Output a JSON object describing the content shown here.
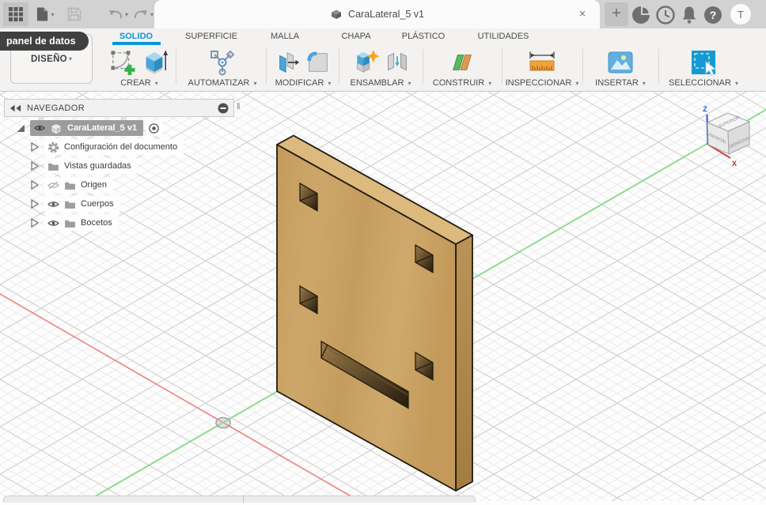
{
  "ui": {
    "caret": "▾",
    "close": "×",
    "plus": "+",
    "question": "?",
    "avatar": "T",
    "handle": "‖"
  },
  "titlebar": {
    "document_title": "CaraLateral_5 v1"
  },
  "data_panel_tooltip": "panel de datos",
  "design_menu": {
    "label": "DISEÑO"
  },
  "ribbon": {
    "tabs": [
      {
        "label": "SOLIDO",
        "active": true
      },
      {
        "label": "SUPERFICIE"
      },
      {
        "label": "MALLA"
      },
      {
        "label": "CHAPA"
      },
      {
        "label": "PLÁSTICO"
      },
      {
        "label": "UTILIDADES"
      }
    ],
    "groups": [
      {
        "label": "CREAR"
      },
      {
        "label": "AUTOMATIZAR"
      },
      {
        "label": "MODIFICAR"
      },
      {
        "label": "ENSAMBLAR"
      },
      {
        "label": "CONSTRUIR"
      },
      {
        "label": "INSPECCIONAR"
      },
      {
        "label": "INSERTAR"
      },
      {
        "label": "SELECCIONAR"
      }
    ]
  },
  "navigator": {
    "title": "NAVEGADOR",
    "items": [
      {
        "label": "CaraLateral_5 v1",
        "icon": "document-cube",
        "visibility": "visible",
        "selected": true,
        "activated": true
      },
      {
        "label": "Configuración del documento",
        "icon": "gear"
      },
      {
        "label": "Vistas guardadas",
        "icon": "folder"
      },
      {
        "label": "Origen",
        "icon": "folder",
        "visibility": "hidden"
      },
      {
        "label": "Cuerpos",
        "icon": "folder",
        "visibility": "visible"
      },
      {
        "label": "Bocetos",
        "icon": "folder",
        "visibility": "visible"
      }
    ]
  },
  "viewcube": {
    "top": "SUPERIOR",
    "front": "FRONTAL",
    "right": "DERECHA",
    "axis_x": "X",
    "axis_z": "Z"
  },
  "colors": {
    "accent_blue": "#0a96d2",
    "model_front": "#c9a264",
    "model_top": "#dcba7d",
    "model_side": "#b28a4e",
    "axis_x_red": "#ee8080",
    "axis_y_green": "#7ddc7d",
    "viewcube_z_blue": "#3a5fd9"
  }
}
